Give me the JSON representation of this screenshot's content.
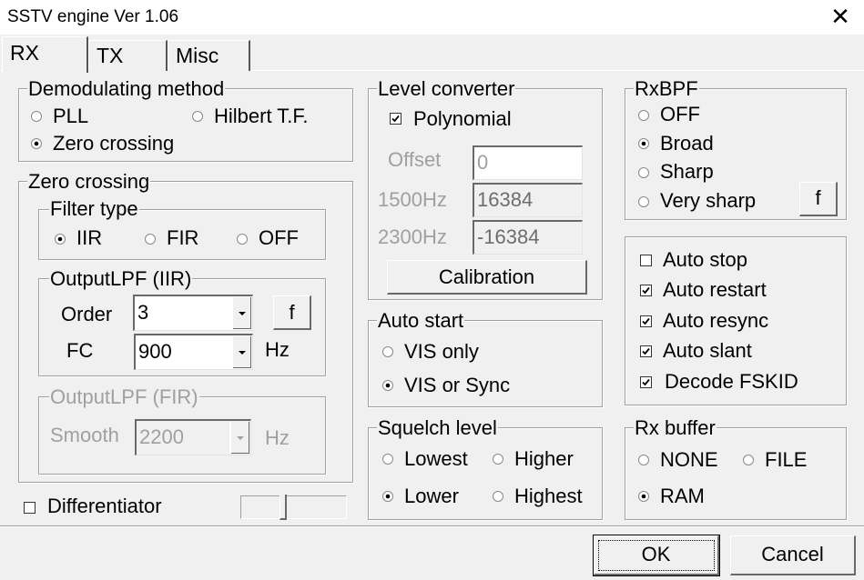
{
  "window": {
    "title": "SSTV engine Ver 1.06",
    "close_glyph": "✕"
  },
  "tabs": [
    {
      "label": "RX",
      "active": true
    },
    {
      "label": "TX",
      "active": false
    },
    {
      "label": "Misc",
      "active": false
    }
  ],
  "demod": {
    "legend": "Demodulating method",
    "options": [
      {
        "label": "PLL",
        "selected": false
      },
      {
        "label": "Hilbert T.F.",
        "selected": false
      },
      {
        "label": "Zero crossing",
        "selected": true
      }
    ]
  },
  "zero_crossing": {
    "legend": "Zero crossing",
    "filter_type": {
      "legend": "Filter type",
      "options": [
        {
          "label": "IIR",
          "selected": true
        },
        {
          "label": "FIR",
          "selected": false
        },
        {
          "label": "OFF",
          "selected": false
        }
      ]
    },
    "lpf_iir": {
      "legend": "OutputLPF (IIR)",
      "order_label": "Order",
      "order_value": "3",
      "fc_label": "FC",
      "fc_value": "900",
      "unit": "Hz",
      "f_button": "f"
    },
    "lpf_fir": {
      "legend": "OutputLPF (FIR)",
      "smooth_label": "Smooth",
      "smooth_value": "2200",
      "unit": "Hz"
    }
  },
  "differentiator": {
    "label": "Differentiator",
    "checked": false
  },
  "level_converter": {
    "legend": "Level converter",
    "polynomial_label": "Polynomial",
    "polynomial_checked": true,
    "offset_label": "Offset",
    "offset_value": "0",
    "f1500_label": "1500Hz",
    "f1500_value": "16384",
    "f2300_label": "2300Hz",
    "f2300_value": "-16384",
    "calibration_button": "Calibration"
  },
  "auto_start": {
    "legend": "Auto start",
    "options": [
      {
        "label": "VIS only",
        "selected": false
      },
      {
        "label": "VIS or Sync",
        "selected": true
      }
    ]
  },
  "squelch": {
    "legend": "Squelch level",
    "options": [
      {
        "label": "Lowest",
        "selected": false
      },
      {
        "label": "Higher",
        "selected": false
      },
      {
        "label": "Lower",
        "selected": true
      },
      {
        "label": "Highest",
        "selected": false
      }
    ]
  },
  "rxbpf": {
    "legend": "RxBPF",
    "options": [
      {
        "label": "OFF",
        "selected": false
      },
      {
        "label": "Broad",
        "selected": true
      },
      {
        "label": "Sharp",
        "selected": false
      },
      {
        "label": "Very sharp",
        "selected": false
      }
    ],
    "f_button": "f"
  },
  "auto_opts": [
    {
      "label": "Auto stop",
      "checked": false
    },
    {
      "label": "Auto restart",
      "checked": true
    },
    {
      "label": "Auto resync",
      "checked": true
    },
    {
      "label": "Auto slant",
      "checked": true
    },
    {
      "label": "Decode FSKID",
      "checked": true
    }
  ],
  "rx_buffer": {
    "legend": "Rx buffer",
    "options": [
      {
        "label": "NONE",
        "selected": false
      },
      {
        "label": "FILE",
        "selected": false
      },
      {
        "label": "RAM",
        "selected": true
      }
    ]
  },
  "buttons": {
    "ok": "OK",
    "cancel": "Cancel"
  }
}
